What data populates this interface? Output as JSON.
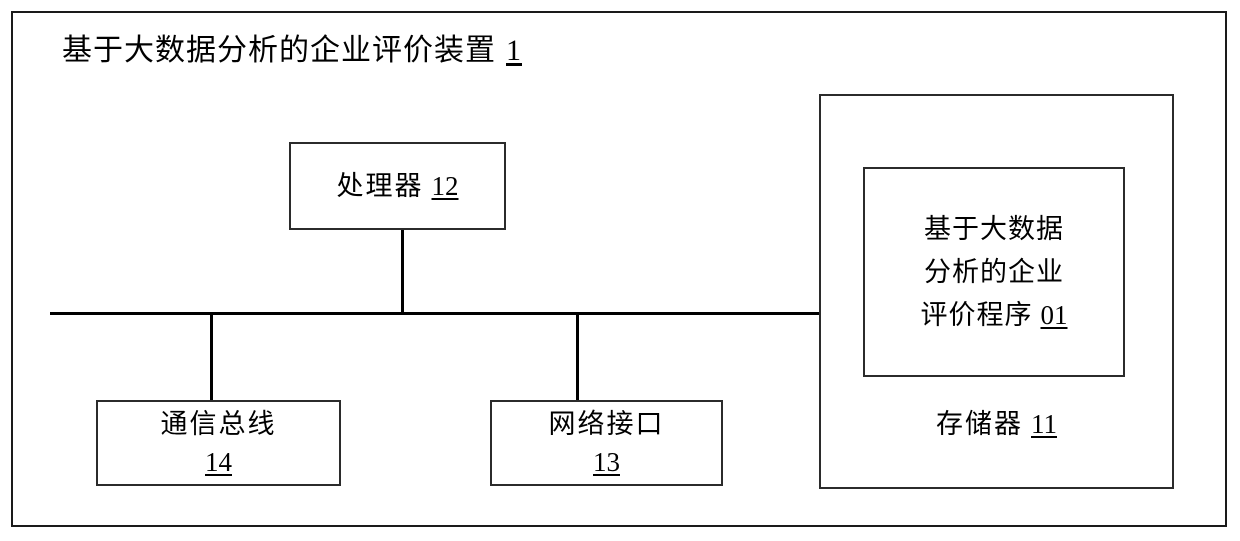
{
  "figure": {
    "title_text": "基于大数据分析的企业评价装置",
    "title_ref": "1"
  },
  "components": {
    "processor": {
      "label": "处理器",
      "ref": "12"
    },
    "comm_bus": {
      "label": "通信总线",
      "ref": "14"
    },
    "network_interface": {
      "label": "网络接口",
      "ref": "13"
    },
    "memory": {
      "label": "存储器",
      "ref": "11"
    },
    "program": {
      "line1": "基于大数据",
      "line2": "分析的企业",
      "line3": "评价程序",
      "ref": "01"
    }
  },
  "connections": [
    {
      "from": "processor",
      "to": "bus"
    },
    {
      "from": "comm_bus",
      "to": "bus"
    },
    {
      "from": "network_interface",
      "to": "bus"
    },
    {
      "from": "memory",
      "to": "bus"
    }
  ],
  "colors": {
    "line": "#000000",
    "box_border": "#2b2b2b",
    "frame_border": "#1a1a1a",
    "background": "#ffffff",
    "text": "#000000"
  }
}
